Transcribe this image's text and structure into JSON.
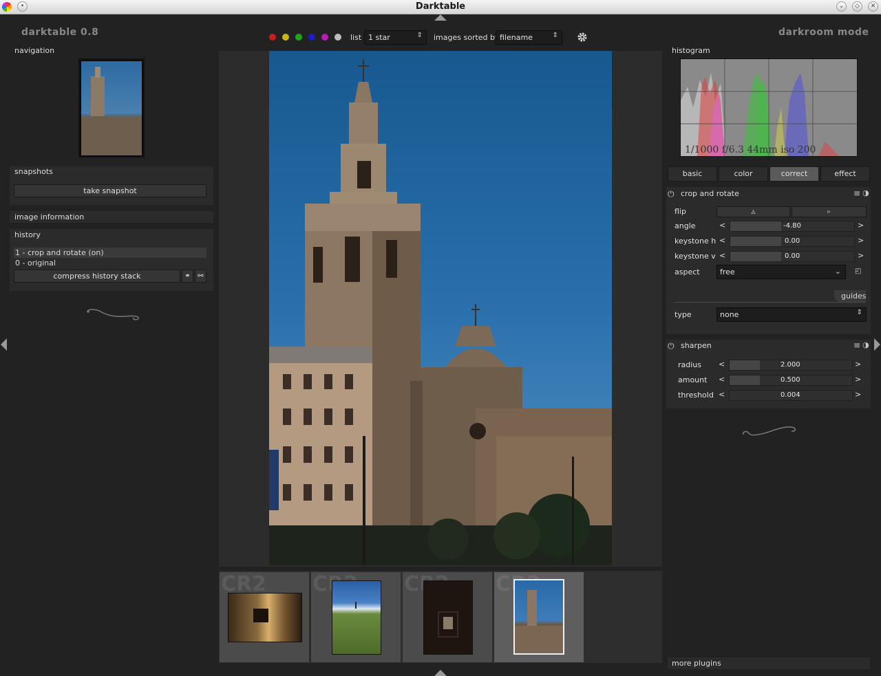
{
  "window": {
    "title": "Darktable"
  },
  "app": {
    "version": "darktable 0.8",
    "mode": "darkroom mode"
  },
  "toolbar": {
    "color_labels": [
      "red",
      "yellow",
      "green",
      "blue",
      "magenta",
      "gray"
    ],
    "colors": {
      "red": "#c81e1e",
      "yellow": "#c8b41e",
      "green": "#1ea51e",
      "blue": "#1e1ec8",
      "magenta": "#b41eb4",
      "gray": "#bdbdbd"
    },
    "list_label": "list",
    "list_value": "1 star",
    "sorted_label": "images sorted by",
    "sorted_value": "filename"
  },
  "left": {
    "navigation_title": "navigation",
    "snapshots_title": "snapshots",
    "take_snapshot": "take snapshot",
    "image_information": "image information",
    "history_title": "history",
    "history_items": [
      "1 - crop and rotate (on)",
      "0 - original"
    ],
    "compress": "compress history stack"
  },
  "right": {
    "histogram_title": "histogram",
    "exif": "1/1000 f/6.3 44mm iso 200",
    "tabs": [
      "basic",
      "color",
      "correct",
      "effect"
    ],
    "active_tab": "correct",
    "crop": {
      "title": "crop and rotate",
      "flip": "flip",
      "angle_label": "angle",
      "angle_value": "-4.80",
      "keystone_h_label": "keystone h",
      "keystone_h_value": "0.00",
      "keystone_v_label": "keystone v",
      "keystone_v_value": "0.00",
      "aspect_label": "aspect",
      "aspect_value": "free",
      "guides": "guides",
      "type_label": "type",
      "type_value": "none"
    },
    "sharpen": {
      "title": "sharpen",
      "radius_label": "radius",
      "radius_value": "2.000",
      "amount_label": "amount",
      "amount_value": "0.500",
      "threshold_label": "threshold",
      "threshold_value": "0.004"
    },
    "more_plugins": "more plugins"
  },
  "filmstrip": {
    "ext_label": "CR2"
  }
}
